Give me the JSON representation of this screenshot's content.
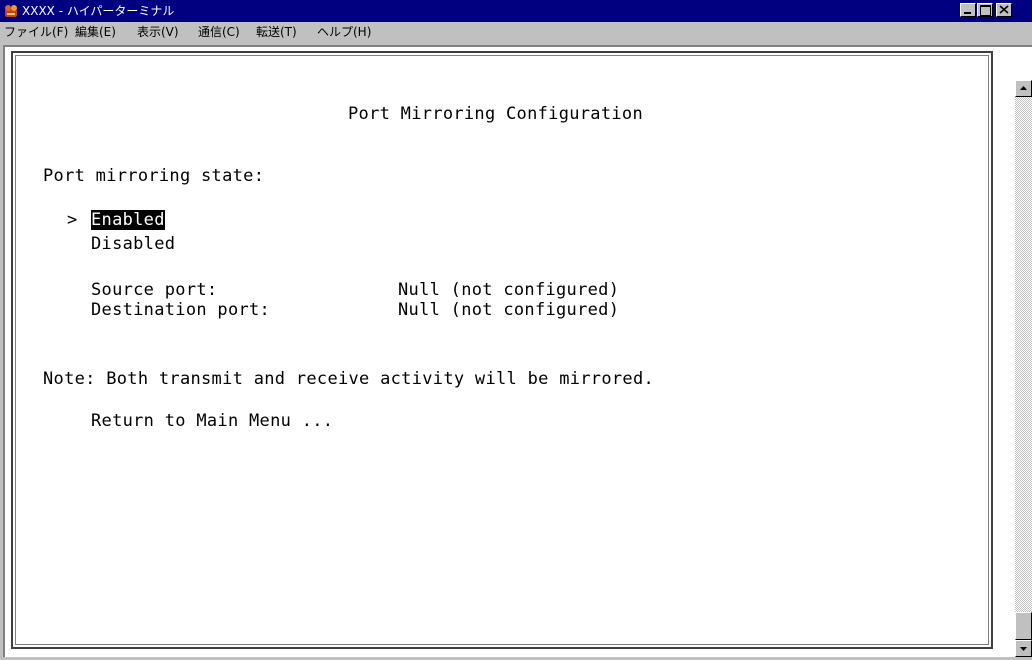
{
  "window": {
    "title": "XXXX - ハイパーターミナル",
    "icon": "hyperterminal-icon",
    "controls": {
      "minimize": "minimize-icon",
      "maximize": "maximize-icon",
      "close": "close-icon"
    }
  },
  "menu": {
    "file": "ファイル(F)",
    "edit": "編集(E)",
    "view": "表示(V)",
    "call": "通信(C)",
    "transfer": "転送(T)",
    "help": "ヘルプ(H)"
  },
  "terminal": {
    "title": "Port Mirroring Configuration",
    "state_label": "Port mirroring state:",
    "cursor": ">",
    "options": [
      "Enabled",
      "Disabled"
    ],
    "selected_option": "Enabled",
    "source_label": "Source port:",
    "source_value": "Null (not configured)",
    "destination_label": "Destination port:",
    "destination_value": "Null (not configured)",
    "note": "Note: Both transmit and receive activity will be mirrored.",
    "return_item": "Return to Main Menu ..."
  },
  "colors": {
    "titlebar": "#000080",
    "window_face": "#c0c0c0",
    "terminal_bg": "#ffffff",
    "highlight_bg": "#000000"
  }
}
